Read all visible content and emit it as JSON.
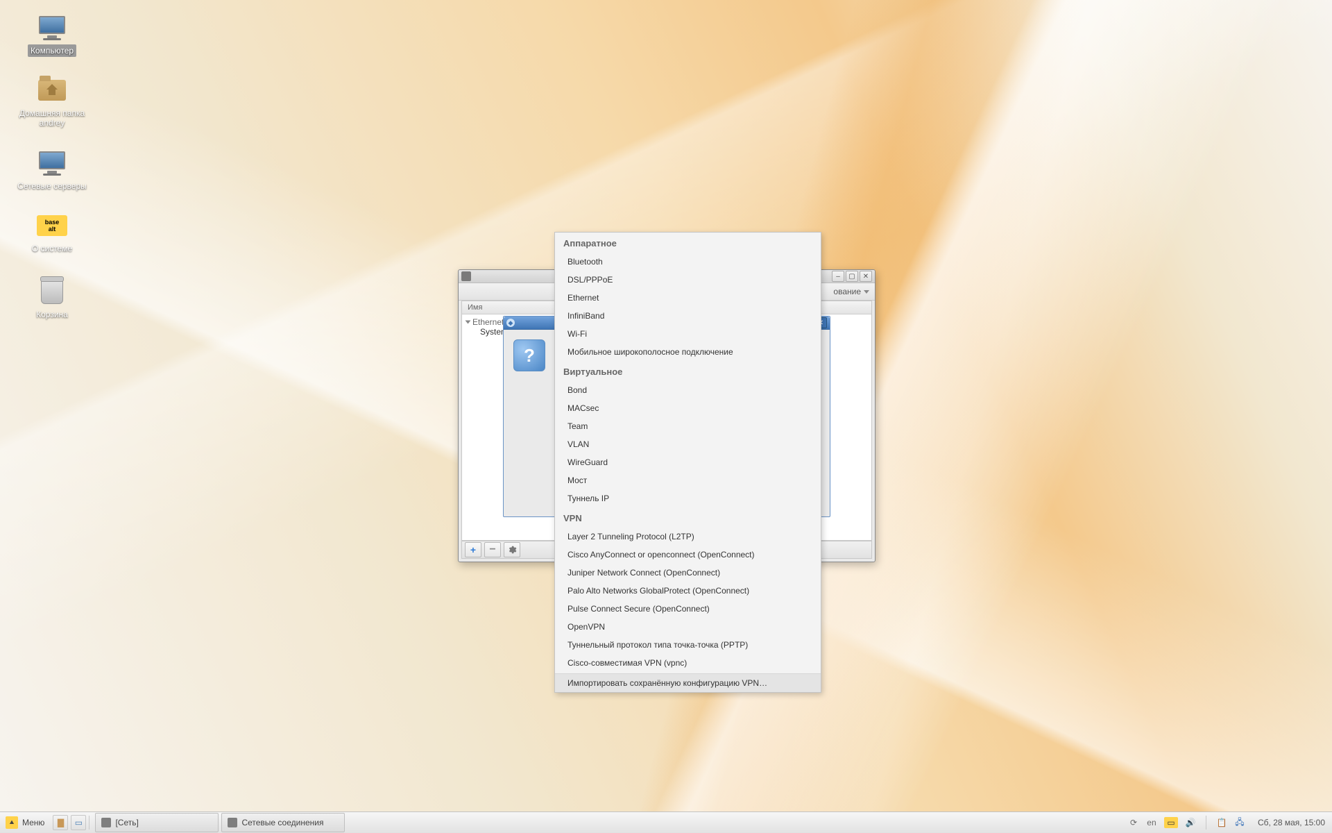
{
  "desktop": {
    "icons": [
      {
        "id": "computer",
        "label": "Компьютер",
        "selected": true
      },
      {
        "id": "home",
        "label": "Домашняя папка andrey",
        "selected": false
      },
      {
        "id": "netservers",
        "label": "Сетевые серверы",
        "selected": false
      },
      {
        "id": "about",
        "label": "О системе",
        "selected": false
      },
      {
        "id": "trash",
        "label": "Корзина",
        "selected": false
      }
    ]
  },
  "win_connections": {
    "toolbar_dropdown": "ование",
    "col_name": "Имя",
    "tree_group": "Ethernet",
    "tree_item": "System",
    "btn_add_tooltip": "plus",
    "btn_remove_tooltip": "minus",
    "btn_settings_tooltip": "settings"
  },
  "dialog": {
    "title": "",
    "icon": "?"
  },
  "menu": {
    "sections": [
      {
        "header": "Аппаратное",
        "items": [
          "Bluetooth",
          "DSL/PPPoE",
          "Ethernet",
          "InfiniBand",
          "Wi-Fi",
          "Мобильное широкополосное подключение"
        ]
      },
      {
        "header": "Виртуальное",
        "items": [
          "Bond",
          "MACsec",
          "Team",
          "VLAN",
          "WireGuard",
          "Мост",
          "Туннель IP"
        ]
      },
      {
        "header": "VPN",
        "items": [
          "Layer 2 Tunneling Protocol (L2TP)",
          "Cisco AnyConnect or openconnect (OpenConnect)",
          "Juniper Network Connect (OpenConnect)",
          "Palo Alto Networks GlobalProtect (OpenConnect)",
          "Pulse Connect Secure (OpenConnect)",
          "OpenVPN",
          "Туннельный протокол типа точка-точка (PPTP)",
          "Cisco-совместимая VPN (vpnc)"
        ]
      }
    ],
    "footer": "Импортировать сохранённую конфигурацию VPN…"
  },
  "taskbar": {
    "menu": "Меню",
    "tasks": [
      {
        "id": "net",
        "label": "[Сеть]"
      },
      {
        "id": "nmce",
        "label": "Сетевые соединения"
      }
    ],
    "lang": "en",
    "clock": "Сб, 28 мая, 15:00"
  }
}
